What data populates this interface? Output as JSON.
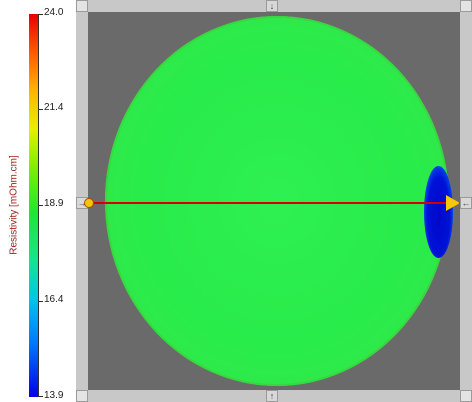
{
  "color_scale": {
    "title": "Resistivity [mOhm.cm]",
    "max": "24.0",
    "ticks": [
      {
        "label": "21.4",
        "value": 21.4
      },
      {
        "label": "18.9",
        "value": 18.9
      },
      {
        "label": "16.4",
        "value": 16.4
      }
    ],
    "min": "13.9",
    "colors": {
      "high": "#e80000",
      "mid": "#1ee632",
      "low": "#0000e6"
    }
  },
  "map": {
    "background_color": "#6a6a6a",
    "wafer_color": "#2ef052",
    "low_region_color": "#0012d8"
  },
  "profile_line": {
    "color": "#d40000",
    "start_marker_color": "#f0c800",
    "end_marker_color": "#f8c800"
  },
  "icons": {
    "top_handle": "arrow-down-icon",
    "bottom_handle": "arrow-up-icon",
    "left_handle": "arrow-right-icon",
    "right_handle": "arrow-left-icon",
    "corner": "corner-handle-icon"
  }
}
